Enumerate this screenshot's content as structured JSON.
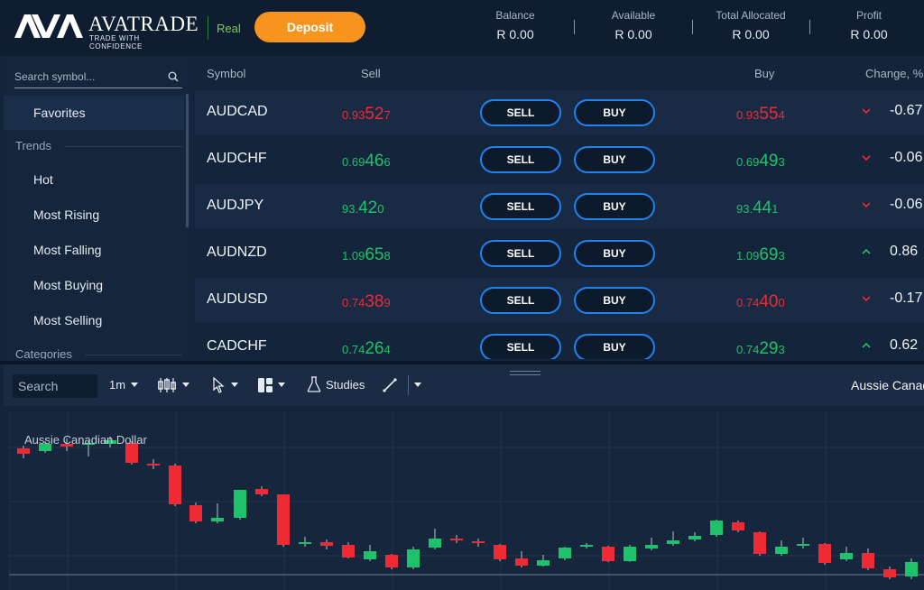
{
  "header": {
    "logo_word": "AVATRADE",
    "logo_tagline": "TRADE WITH CONFIDENCE",
    "account_mode": "Real",
    "deposit_label": "Deposit",
    "stats": [
      {
        "label": "Balance",
        "value": "R 0.00"
      },
      {
        "label": "Available",
        "value": "R 0.00"
      },
      {
        "label": "Total Allocated",
        "value": "R 0.00"
      },
      {
        "label": "Profit",
        "value": "R 0.00"
      }
    ]
  },
  "sidebar": {
    "search_placeholder": "Search symbol...",
    "favorites_label": "Favorites",
    "trends_label": "Trends",
    "trend_items": [
      "Hot",
      "Most Rising",
      "Most Falling",
      "Most Buying",
      "Most Selling"
    ],
    "categories_label": "Categories"
  },
  "table": {
    "headers": {
      "symbol": "Symbol",
      "sell": "Sell",
      "buy": "Buy",
      "change": "Change, %"
    },
    "sell_label": "SELL",
    "buy_label": "BUY",
    "rows": [
      {
        "symbol": "AUDCAD",
        "sell": [
          "0.93",
          "52",
          "7"
        ],
        "buy": [
          "0.93",
          "55",
          "4"
        ],
        "sell_dir": "down",
        "buy_dir": "down",
        "change_dir": "down",
        "change": "-0.67"
      },
      {
        "symbol": "AUDCHF",
        "sell": [
          "0.69",
          "46",
          "6"
        ],
        "buy": [
          "0.69",
          "49",
          "3"
        ],
        "sell_dir": "up",
        "buy_dir": "up",
        "change_dir": "down",
        "change": "-0.06"
      },
      {
        "symbol": "AUDJPY",
        "sell": [
          "93.",
          "42",
          "0"
        ],
        "buy": [
          "93.",
          "44",
          "1"
        ],
        "sell_dir": "up",
        "buy_dir": "up",
        "change_dir": "down",
        "change": "-0.06"
      },
      {
        "symbol": "AUDNZD",
        "sell": [
          "1.09",
          "65",
          "8"
        ],
        "buy": [
          "1.09",
          "69",
          "3"
        ],
        "sell_dir": "up",
        "buy_dir": "up",
        "change_dir": "up",
        "change": "0.86"
      },
      {
        "symbol": "AUDUSD",
        "sell": [
          "0.74",
          "38",
          "9"
        ],
        "buy": [
          "0.74",
          "40",
          "0"
        ],
        "sell_dir": "down",
        "buy_dir": "down",
        "change_dir": "down",
        "change": "-0.17"
      },
      {
        "symbol": "CADCHF",
        "sell": [
          "0.74",
          "26",
          "4"
        ],
        "buy": [
          "0.74",
          "29",
          "3"
        ],
        "sell_dir": "up",
        "buy_dir": "up",
        "change_dir": "up",
        "change": "0.62"
      }
    ]
  },
  "chart_toolbar": {
    "search_placeholder": "Search",
    "interval": "1m",
    "studies_label": "Studies",
    "symbol_name": "Aussie Canad"
  },
  "chart": {
    "title": "Aussie Canadian Dollar",
    "colors": {
      "up": "#1ec26a",
      "down": "#ed2a35",
      "grid": "#22354f"
    }
  }
}
